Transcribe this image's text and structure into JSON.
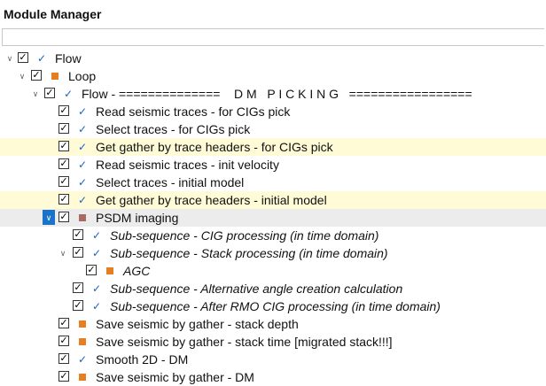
{
  "window": {
    "title": "Module Manager"
  },
  "search": {
    "placeholder": ""
  },
  "tree": [
    {
      "label": "Flow",
      "checked": "✓",
      "status": "tick"
    },
    {
      "label": "Loop",
      "checked": "✓",
      "status": "square"
    },
    {
      "label": "Flow - ==============    D M   P I C K I N G   =================",
      "checked": "✓",
      "status": "tick"
    },
    {
      "label": "Read seismic traces - for CIGs pick",
      "checked": "✓",
      "status": "tick"
    },
    {
      "label": "Select traces - for CIGs pick",
      "checked": "✓",
      "status": "tick"
    },
    {
      "label": "Get gather by trace headers - for CIGs pick",
      "checked": "✓",
      "status": "tick"
    },
    {
      "label": "Read seismic traces - init velocity",
      "checked": "✓",
      "status": "tick"
    },
    {
      "label": "Select traces - initial model",
      "checked": "✓",
      "status": "tick"
    },
    {
      "label": "Get gather by trace headers - initial model",
      "checked": "✓",
      "status": "tick"
    },
    {
      "label": "PSDM imaging",
      "checked": "✓",
      "status": "square-muted"
    },
    {
      "label": "Sub-sequence - CIG processing (in time domain)",
      "checked": "✓",
      "status": "tick"
    },
    {
      "label": "Sub-sequence - Stack processing (in time domain)",
      "checked": "✓",
      "status": "tick"
    },
    {
      "label": "AGC",
      "checked": "✓",
      "status": "square"
    },
    {
      "label": "Sub-sequence - Alternative angle creation calculation",
      "checked": "✓",
      "status": "tick"
    },
    {
      "label": "Sub-sequence - After RMO CIG processing (in time domain)",
      "checked": "✓",
      "status": "tick"
    },
    {
      "label": "Save seismic by gather - stack depth",
      "checked": "✓",
      "status": "square"
    },
    {
      "label": "Save seismic by gather - stack time [migrated stack!!!]",
      "checked": "✓",
      "status": "square"
    },
    {
      "label": "Smooth 2D - DM",
      "checked": "✓",
      "status": "tick"
    },
    {
      "label": "Save seismic by gather - DM",
      "checked": "✓",
      "status": "square"
    }
  ],
  "icons": {
    "tick": "checkmark-icon",
    "square": "orange-square-icon",
    "square-muted": "brown-square-icon"
  },
  "colors": {
    "highlight": "#fefbd6",
    "selected": "#ececec",
    "tick": "#1565c0",
    "square": "#e67e22",
    "expander_active": "#1a73c9"
  }
}
